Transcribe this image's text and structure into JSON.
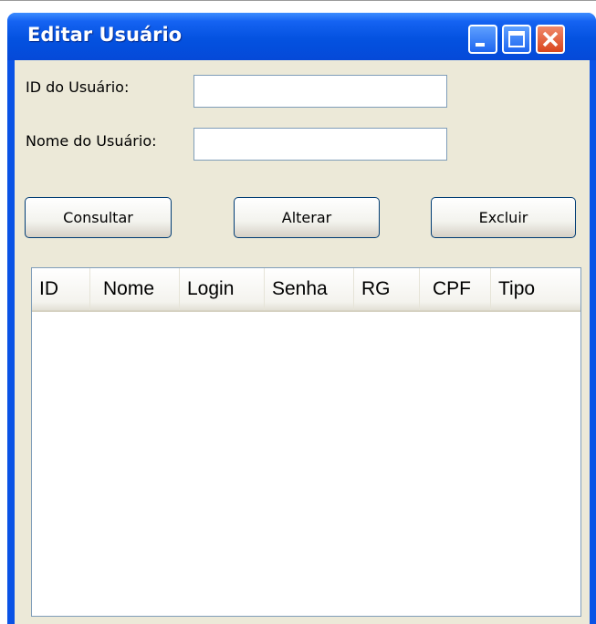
{
  "window": {
    "title": "Editar Usuário"
  },
  "form": {
    "id_label": "ID do Usuário:",
    "id_value": "",
    "name_label": "Nome do Usuário:",
    "name_value": ""
  },
  "buttons": {
    "consultar": "Consultar",
    "alterar": "Alterar",
    "excluir": "Excluir"
  },
  "table": {
    "columns": [
      "ID",
      "Nome",
      "Login",
      "Senha",
      "RG",
      "CPF",
      "Tipo"
    ],
    "rows": []
  },
  "colors": {
    "titlebar": "#0a53e6",
    "client_bg": "#ece9d8",
    "close_button": "#d9461e"
  }
}
